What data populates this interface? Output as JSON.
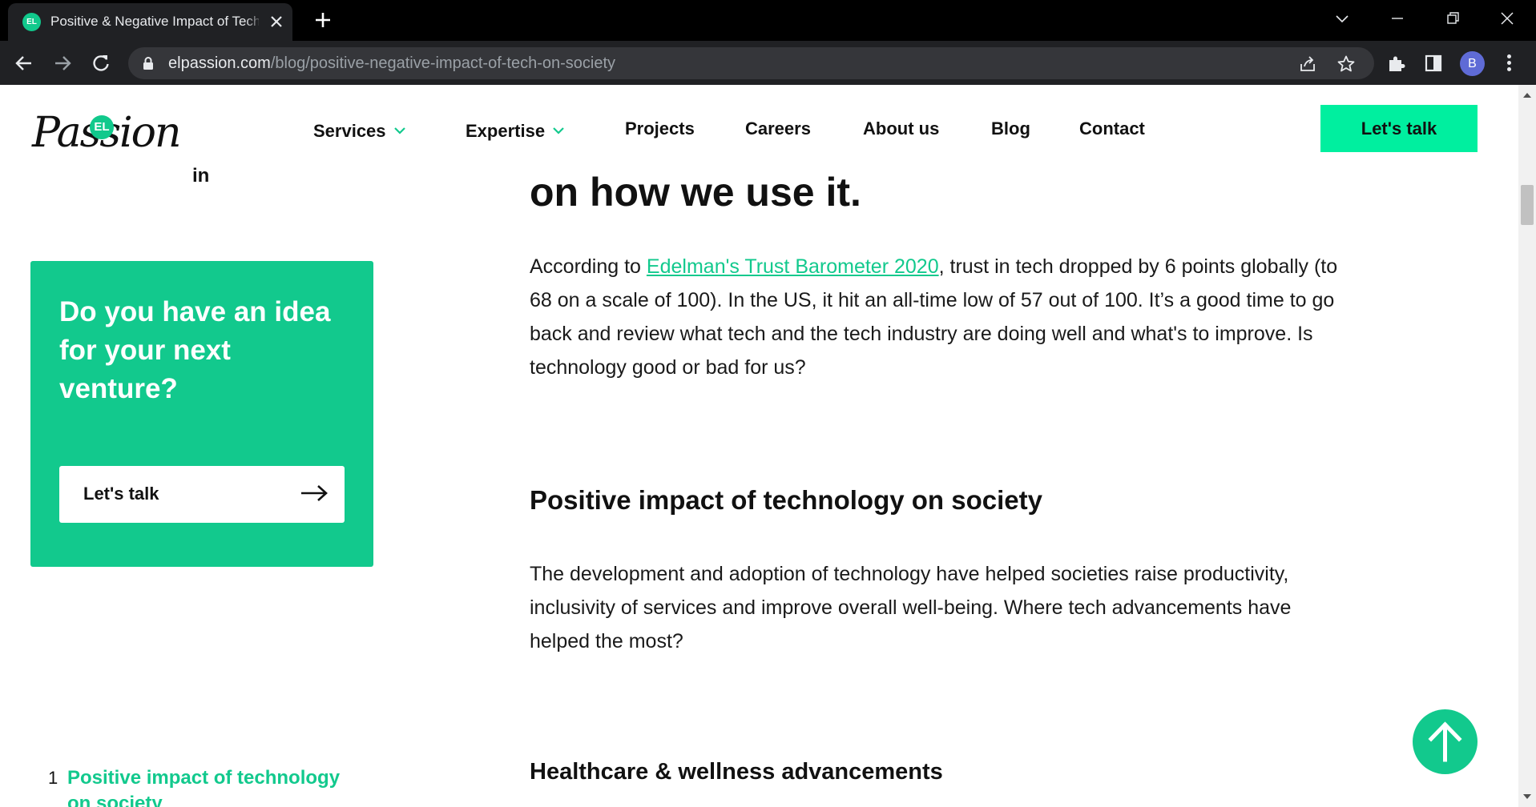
{
  "browser": {
    "tab": {
      "favicon_text": "EL",
      "title": "Positive & Negative Impact of Tech on Society"
    },
    "address": {
      "host": "elpassion.com",
      "path": "/blog/positive-negative-impact-of-tech-on-society"
    },
    "profile_initial": "B"
  },
  "site": {
    "logo": {
      "badge": "EL",
      "wordmark": "Passion"
    },
    "nav": {
      "services": "Services",
      "expertise": "Expertise",
      "projects": "Projects",
      "careers": "Careers",
      "about": "About us",
      "blog": "Blog",
      "contact": "Contact"
    },
    "cta": "Let's talk"
  },
  "sidebar": {
    "fragment": "in",
    "promo": {
      "title": "Do you have an idea for your next venture?",
      "button": "Let's talk"
    },
    "toc": [
      {
        "number": "1",
        "label": "Positive impact of technology on society"
      }
    ]
  },
  "article": {
    "heading_fragment": "on how we use it.",
    "intro": {
      "before": "According to ",
      "link_text": "Edelman's Trust Barometer 2020",
      "after": ", trust in tech dropped by 6 points globally (to 68 on a scale of 100). In the US, it hit an all-time low of 57 out of 100. It’s a good time to go back and review what tech and the tech industry are doing well and what's to improve. Is technology good or bad for us?"
    },
    "section1_title": "Positive impact of technology on society",
    "section1_body": "The development and adoption of technology have helped societies raise productivity, inclusivity of services and improve overall well-being. Where tech advancements have helped the most?",
    "section2_title": "Healthcare & wellness advancements"
  },
  "colors": {
    "brand_green": "#12c98d",
    "cta_green": "#00ef9f"
  }
}
